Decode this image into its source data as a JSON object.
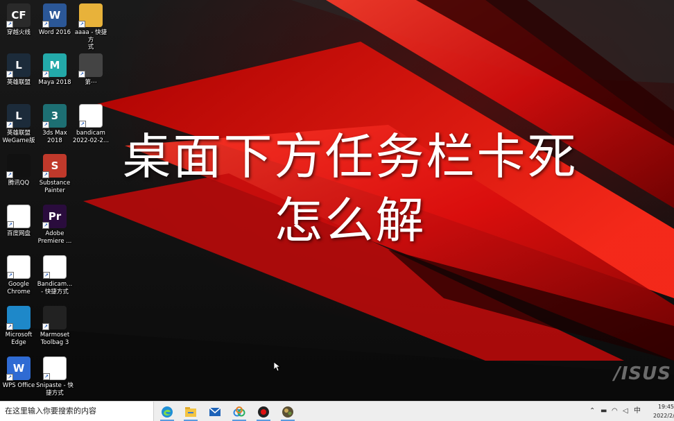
{
  "desktop": {
    "icons": [
      {
        "label": "穿越火线",
        "icon": "crossfire-icon",
        "color": "#2a2a2a",
        "text": "CF"
      },
      {
        "label": "Word 2016",
        "icon": "word-icon",
        "color": "#2b5797",
        "text": "W"
      },
      {
        "label": "aaaa - 快捷方\n式",
        "icon": "folder-icon",
        "color": "#e8b23a",
        "text": ""
      },
      {
        "label": "英雄联盟",
        "icon": "league-icon",
        "color": "#1c2b3a",
        "text": "L"
      },
      {
        "label": "Maya 2018",
        "icon": "maya-icon",
        "color": "#23a9a9",
        "text": "M"
      },
      {
        "label": "第⋯",
        "icon": "video-thumbnail-icon",
        "color": "#444444",
        "text": ""
      },
      {
        "label": "英雄联盟\nWeGame版",
        "icon": "league-wegame-icon",
        "color": "#1c2b3a",
        "text": "L"
      },
      {
        "label": "3ds Max\n2018",
        "icon": "3dsmax-icon",
        "color": "#1d6f73",
        "text": "3"
      },
      {
        "label": "bandicam\n2022-02-2...",
        "icon": "video-file-icon",
        "color": "#ffffff",
        "text": ""
      },
      {
        "label": "腾讯QQ",
        "icon": "qq-icon",
        "color": "#111111",
        "text": ""
      },
      {
        "label": "Substance\nPainter",
        "icon": "substance-painter-icon",
        "color": "#c0392b",
        "text": "S"
      },
      {
        "label": "百度网盘",
        "icon": "baidu-netdisk-icon",
        "color": "#ffffff",
        "text": ""
      },
      {
        "label": "Adobe\nPremiere ...",
        "icon": "premiere-icon",
        "color": "#2a0c3d",
        "text": "Pr"
      },
      {
        "label": "Google\nChrome",
        "icon": "chrome-icon",
        "color": "#ffffff",
        "text": ""
      },
      {
        "label": "Bandicam...\n- 快捷方式",
        "icon": "bandicam-icon",
        "color": "#ffffff",
        "text": ""
      },
      {
        "label": "Microsoft\nEdge",
        "icon": "edge-icon",
        "color": "#1e88c9",
        "text": ""
      },
      {
        "label": "Marmoset\nToolbag 3",
        "icon": "marmoset-icon",
        "color": "#222222",
        "text": ""
      },
      {
        "label": "WPS Office",
        "icon": "wps-icon",
        "color": "#2f6bd3",
        "text": "W"
      },
      {
        "label": "Snipaste - 快\n捷方式",
        "icon": "snipaste-icon",
        "color": "#ffffff",
        "text": ""
      }
    ]
  },
  "overlay": {
    "line1": "桌面下方任务栏卡死",
    "line2": "怎么解"
  },
  "brand_logo": "/ISUS",
  "taskbar": {
    "search_placeholder": "在这里输入你要搜索的内容",
    "apps": [
      "edge-icon",
      "file-explorer-icon",
      "mail-icon",
      "baidu-netdisk-icon",
      "bandicam-icon",
      "app-icon"
    ],
    "tray": {
      "ime": "中",
      "time": "19:45",
      "date": "2022/2/"
    }
  },
  "colors": {
    "taskbar_bg": "#eeeeee",
    "accent_red": "#e01010"
  }
}
